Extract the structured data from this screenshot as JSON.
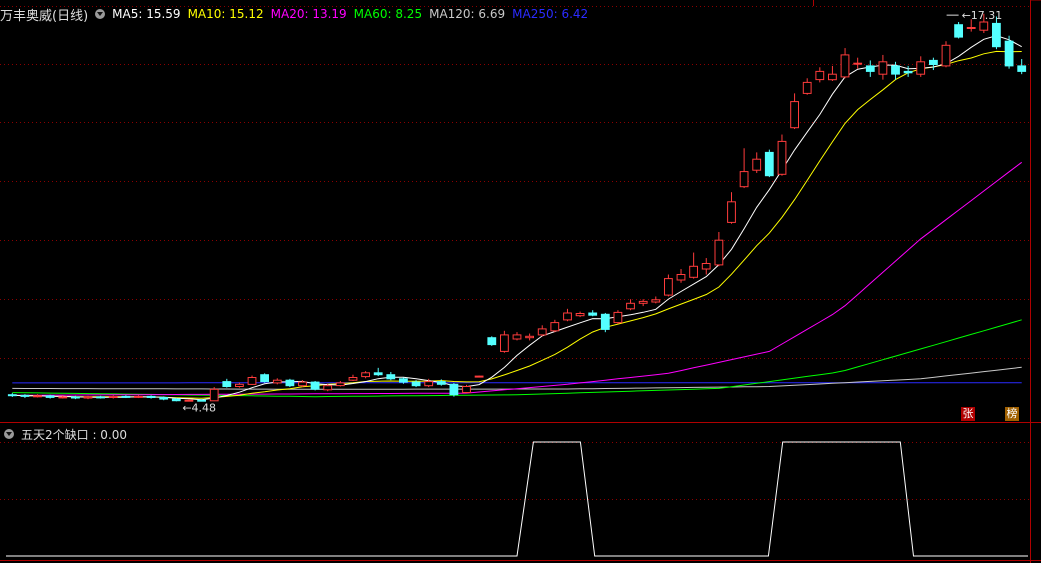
{
  "main_panel": {
    "title": "万丰奥威(日线)",
    "ma_legend": [
      {
        "label": "MA5: 15.59",
        "color": "#ffffff"
      },
      {
        "label": "MA10: 15.12",
        "color": "#ffff00"
      },
      {
        "label": "MA20: 13.19",
        "color": "#ff00ff"
      },
      {
        "label": "MA60: 8.25",
        "color": "#00ff00"
      },
      {
        "label": "MA120: 6.69",
        "color": "#c8c8c8"
      },
      {
        "label": "MA250: 6.42",
        "color": "#2b2bff"
      }
    ],
    "high_label": "17.31",
    "low_label": "4.48",
    "badge_zhang": "张",
    "badge_bang": "榜"
  },
  "sub_panel": {
    "title": "五天2个缺口 : 0.00"
  },
  "colors": {
    "up": "#ff3c3c",
    "down": "#54ffff",
    "grid": "#8b0000",
    "axis": "#b00000"
  },
  "chart_data": [
    {
      "type": "candlestick",
      "ylim": [
        3.8,
        18.3
      ],
      "candles": [
        [
          4.72,
          4.7,
          4.78,
          4.64
        ],
        [
          4.7,
          4.66,
          4.74,
          4.6
        ],
        [
          4.66,
          4.68,
          4.74,
          4.62
        ],
        [
          4.68,
          4.62,
          4.72,
          4.58
        ],
        [
          4.62,
          4.64,
          4.7,
          4.58
        ],
        [
          4.64,
          4.6,
          4.68,
          4.56
        ],
        [
          4.6,
          4.64,
          4.68,
          4.56
        ],
        [
          4.64,
          4.62,
          4.68,
          4.58
        ],
        [
          4.62,
          4.66,
          4.7,
          4.58
        ],
        [
          4.66,
          4.64,
          4.7,
          4.6
        ],
        [
          4.64,
          4.66,
          4.7,
          4.6
        ],
        [
          4.66,
          4.62,
          4.7,
          4.58
        ],
        [
          4.62,
          4.56,
          4.66,
          4.52
        ],
        [
          4.56,
          4.5,
          4.6,
          4.48
        ],
        [
          4.5,
          4.52,
          4.56,
          4.48
        ],
        [
          4.52,
          4.5,
          4.56,
          4.48
        ],
        [
          4.5,
          4.92,
          5.0,
          4.5
        ],
        [
          5.2,
          5.02,
          5.3,
          4.98
        ],
        [
          5.02,
          5.1,
          5.16,
          4.98
        ],
        [
          5.1,
          5.35,
          5.42,
          5.08
        ],
        [
          5.45,
          5.2,
          5.5,
          5.16
        ],
        [
          5.15,
          5.25,
          5.32,
          5.1
        ],
        [
          5.25,
          5.05,
          5.3,
          5.0
        ],
        [
          5.05,
          5.18,
          5.25,
          5.0
        ],
        [
          5.18,
          4.92,
          5.22,
          4.88
        ],
        [
          4.9,
          5.05,
          5.12,
          4.85
        ],
        [
          5.05,
          5.15,
          5.22,
          5.02
        ],
        [
          5.25,
          5.35,
          5.45,
          5.22
        ],
        [
          5.38,
          5.52,
          5.58,
          5.32
        ],
        [
          5.52,
          5.45,
          5.7,
          5.4
        ],
        [
          5.45,
          5.3,
          5.55,
          5.25
        ],
        [
          5.3,
          5.18,
          5.35,
          5.12
        ],
        [
          5.18,
          5.05,
          5.25,
          5.0
        ],
        [
          5.05,
          5.2,
          5.3,
          5.0
        ],
        [
          5.2,
          5.1,
          5.28,
          5.05
        ],
        [
          5.1,
          4.72,
          5.15,
          4.65
        ],
        [
          4.8,
          5.02,
          5.08,
          4.78
        ],
        [
          5.4,
          5.4,
          5.42,
          5.38
        ],
        [
          6.8,
          6.55,
          6.85,
          6.5
        ],
        [
          6.3,
          6.9,
          7.05,
          6.25
        ],
        [
          6.75,
          6.9,
          7.0,
          6.7
        ],
        [
          6.8,
          6.85,
          6.95,
          6.7
        ],
        [
          6.9,
          7.12,
          7.25,
          6.85
        ],
        [
          7.05,
          7.35,
          7.45,
          7.0
        ],
        [
          7.45,
          7.7,
          7.85,
          7.4
        ],
        [
          7.6,
          7.68,
          7.75,
          7.55
        ],
        [
          7.7,
          7.62,
          7.8,
          7.58
        ],
        [
          7.65,
          7.1,
          7.7,
          7.0
        ],
        [
          7.35,
          7.72,
          7.8,
          7.3
        ],
        [
          7.85,
          8.05,
          8.2,
          7.8
        ],
        [
          8.05,
          8.12,
          8.2,
          7.95
        ],
        [
          8.1,
          8.18,
          8.3,
          8.05
        ],
        [
          8.35,
          8.95,
          9.1,
          8.3
        ],
        [
          8.9,
          9.1,
          9.3,
          8.8
        ],
        [
          9.0,
          9.4,
          9.9,
          8.95
        ],
        [
          9.3,
          9.5,
          9.7,
          9.1
        ],
        [
          9.45,
          10.35,
          10.65,
          9.4
        ],
        [
          11.0,
          11.75,
          12.1,
          10.95
        ],
        [
          12.3,
          12.85,
          13.7,
          12.25
        ],
        [
          12.9,
          13.3,
          13.55,
          12.8
        ],
        [
          13.55,
          12.7,
          13.65,
          12.65
        ],
        [
          12.75,
          13.95,
          14.2,
          12.7
        ],
        [
          14.45,
          15.4,
          15.7,
          14.4
        ],
        [
          15.7,
          16.1,
          16.25,
          15.65
        ],
        [
          16.2,
          16.5,
          16.65,
          16.1
        ],
        [
          16.2,
          16.4,
          16.7,
          16.15
        ],
        [
          16.3,
          17.1,
          17.35,
          16.25
        ],
        [
          16.8,
          16.8,
          17.0,
          16.6
        ],
        [
          16.7,
          16.5,
          16.9,
          16.3
        ],
        [
          16.4,
          16.85,
          17.1,
          16.2
        ],
        [
          16.7,
          16.4,
          16.85,
          16.2
        ],
        [
          16.5,
          16.45,
          16.7,
          16.3
        ],
        [
          16.4,
          16.85,
          17.05,
          16.3
        ],
        [
          16.9,
          16.75,
          17.0,
          16.55
        ],
        [
          16.7,
          17.45,
          17.6,
          16.65
        ],
        [
          18.2,
          17.75,
          18.3,
          17.7
        ],
        [
          18.1,
          18.1,
          18.4,
          17.95
        ],
        [
          18.0,
          18.3,
          18.6,
          17.9
        ],
        [
          18.25,
          17.4,
          18.5,
          17.31
        ],
        [
          17.6,
          16.7,
          17.8,
          16.6
        ],
        [
          16.7,
          16.5,
          16.95,
          16.4
        ]
      ],
      "ma_series": [
        {
          "name": "MA250",
          "values": [
            [
              0,
              5.15
            ],
            [
              0.5,
              5.16
            ],
            [
              1,
              5.16
            ]
          ]
        },
        {
          "name": "MA120",
          "values": [
            [
              0,
              4.95
            ],
            [
              0.3,
              4.92
            ],
            [
              0.55,
              4.93
            ],
            [
              0.75,
              5.02
            ],
            [
              0.9,
              5.3
            ],
            [
              1,
              5.72
            ]
          ]
        },
        {
          "name": "MA60",
          "values": [
            [
              0,
              4.8
            ],
            [
              0.3,
              4.65
            ],
            [
              0.5,
              4.72
            ],
            [
              0.7,
              4.95
            ],
            [
              0.82,
              5.55
            ],
            [
              0.92,
              6.6
            ],
            [
              1,
              7.45
            ]
          ]
        },
        {
          "name": "MA20",
          "values": [
            [
              0,
              4.7
            ],
            [
              0.45,
              4.78
            ],
            [
              0.55,
              5.1
            ],
            [
              0.65,
              5.5
            ],
            [
              0.75,
              6.3
            ],
            [
              0.82,
              7.8
            ],
            [
              0.9,
              10.4
            ],
            [
              1,
              13.19
            ]
          ]
        }
      ]
    },
    {
      "type": "line",
      "title": "五天2个缺口",
      "ylim": [
        0,
        1
      ],
      "x": [
        0,
        0.5,
        0.516,
        0.562,
        0.576,
        0.746,
        0.76,
        0.875,
        0.888,
        1
      ],
      "values": [
        0,
        0,
        1,
        1,
        0,
        0,
        1,
        1,
        0,
        0
      ]
    }
  ]
}
